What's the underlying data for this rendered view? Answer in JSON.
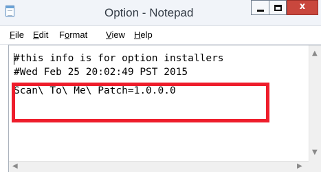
{
  "window": {
    "title": "Option - Notepad",
    "close_glyph": "x"
  },
  "menu": {
    "items": [
      {
        "mnemonic": "F",
        "rest": "ile"
      },
      {
        "mnemonic": "E",
        "rest": "dit"
      },
      {
        "pre": "F",
        "mnemonic": "o",
        "rest": "rmat"
      },
      {
        "mnemonic": "V",
        "rest": "iew"
      },
      {
        "mnemonic": "H",
        "rest": "elp"
      }
    ]
  },
  "editor": {
    "lines": [
      "#this info is for option installers",
      "#Wed Feb 25 20:02:49 PST 2015",
      "Scan\\ To\\ Me\\ Patch=1.0.0.0"
    ]
  },
  "annotation": {
    "color": "#ee1d2b"
  },
  "icons": {
    "app": "notepad-icon",
    "scroll_up": "chevron-up-icon",
    "scroll_down": "chevron-down-icon",
    "scroll_left": "chevron-left-icon",
    "scroll_right": "chevron-right-icon"
  }
}
